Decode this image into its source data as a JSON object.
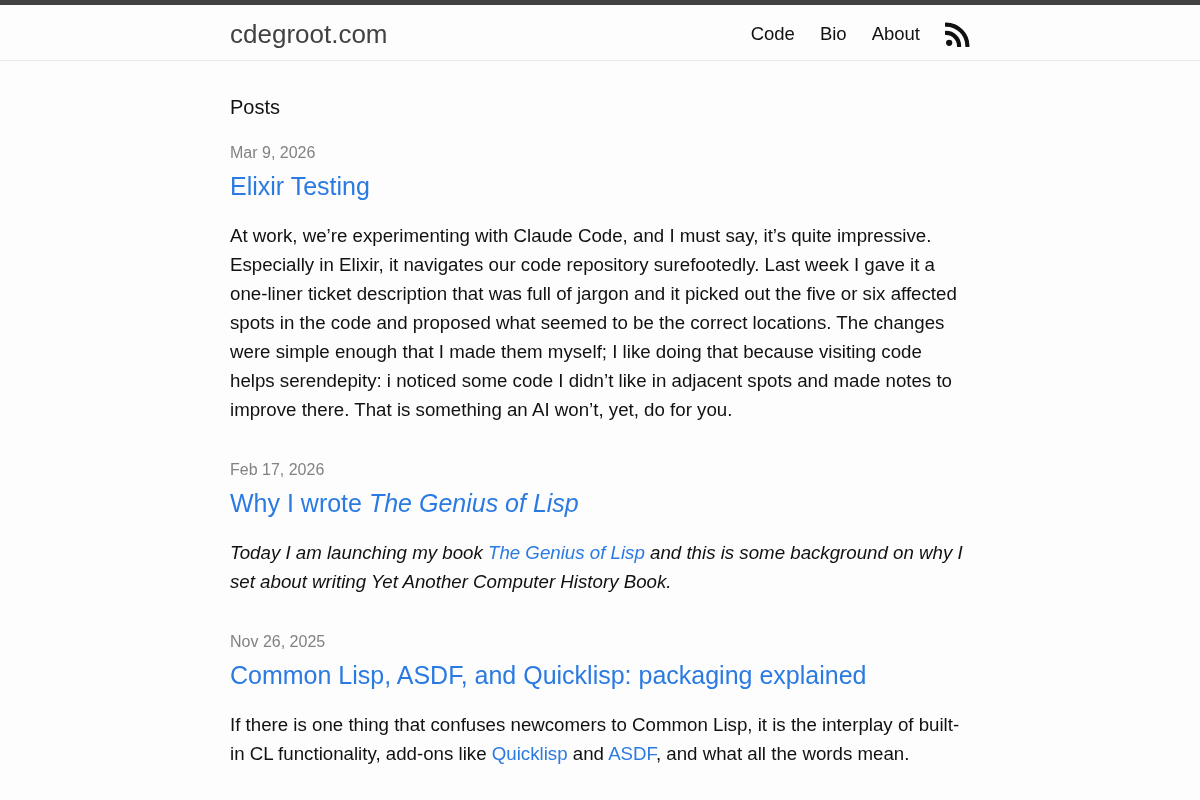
{
  "site": {
    "title": "cdegroot.com",
    "nav": [
      "Code",
      "Bio",
      "About"
    ]
  },
  "page": {
    "heading": "Posts"
  },
  "posts": [
    {
      "date": "Mar 9, 2026",
      "title": "Elixir Testing",
      "excerpt": {
        "italic": false,
        "parts": [
          {
            "kind": "text",
            "text": "At work, we’re experimenting with Claude Code, and I must say, it’s quite impressive. Especially in Elixir, it navigates our code repository surefootedly. Last week I gave it a one-liner ticket description that was full of jargon and it picked out the five or six affected spots in the code and proposed what seemed to be the correct locations. The changes were simple enough that I made them myself; I like doing that because visiting code helps serendepity: i noticed some code I didn’t like in adjacent spots and made notes to improve there. That is something an AI won’t, yet, do for you."
          }
        ]
      }
    },
    {
      "date": "Feb 17, 2026",
      "title": "Why I wrote *The Genius of Lisp*",
      "excerpt": {
        "italic": true,
        "parts": [
          {
            "kind": "text",
            "text": "Today I am launching my book "
          },
          {
            "kind": "link",
            "text": "The Genius of Lisp"
          },
          {
            "kind": "text",
            "text": " and this is some background on why I set about writing Yet Another Computer History Book."
          }
        ]
      }
    },
    {
      "date": "Nov 26, 2025",
      "title": "Common Lisp, ASDF, and Quicklisp: packaging explained",
      "excerpt": {
        "italic": false,
        "parts": [
          {
            "kind": "text",
            "text": "If there is one thing that confuses newcomers to Common Lisp, it is the interplay of built-in CL functionality, add-ons like "
          },
          {
            "kind": "link",
            "text": "Quicklisp"
          },
          {
            "kind": "text",
            "text": " and "
          },
          {
            "kind": "link",
            "text": "ASDF"
          },
          {
            "kind": "text",
            "text": ", and what all the words mean."
          }
        ]
      }
    }
  ]
}
